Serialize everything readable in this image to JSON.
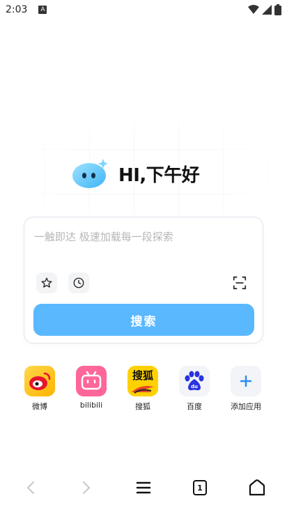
{
  "status_bar": {
    "time": "2:03",
    "notification_badge": "A"
  },
  "greeting": {
    "text": "HI,下午好"
  },
  "search": {
    "placeholder": "一触即达 极速加载每一段探索",
    "button_label": "搜索"
  },
  "shortcuts": [
    {
      "label": "微博",
      "icon": "weibo-icon"
    },
    {
      "label": "bilibili",
      "icon": "bilibili-icon"
    },
    {
      "label": "搜狐",
      "icon": "sohu-icon",
      "icon_text": "搜狐"
    },
    {
      "label": "百度",
      "icon": "baidu-icon",
      "icon_text": "du"
    },
    {
      "label": "添加应用",
      "icon": "add-icon"
    }
  ],
  "bottom_nav": {
    "tab_count": "1"
  },
  "colors": {
    "accent": "#5ab8ff",
    "card_border": "#dfe3ea"
  }
}
